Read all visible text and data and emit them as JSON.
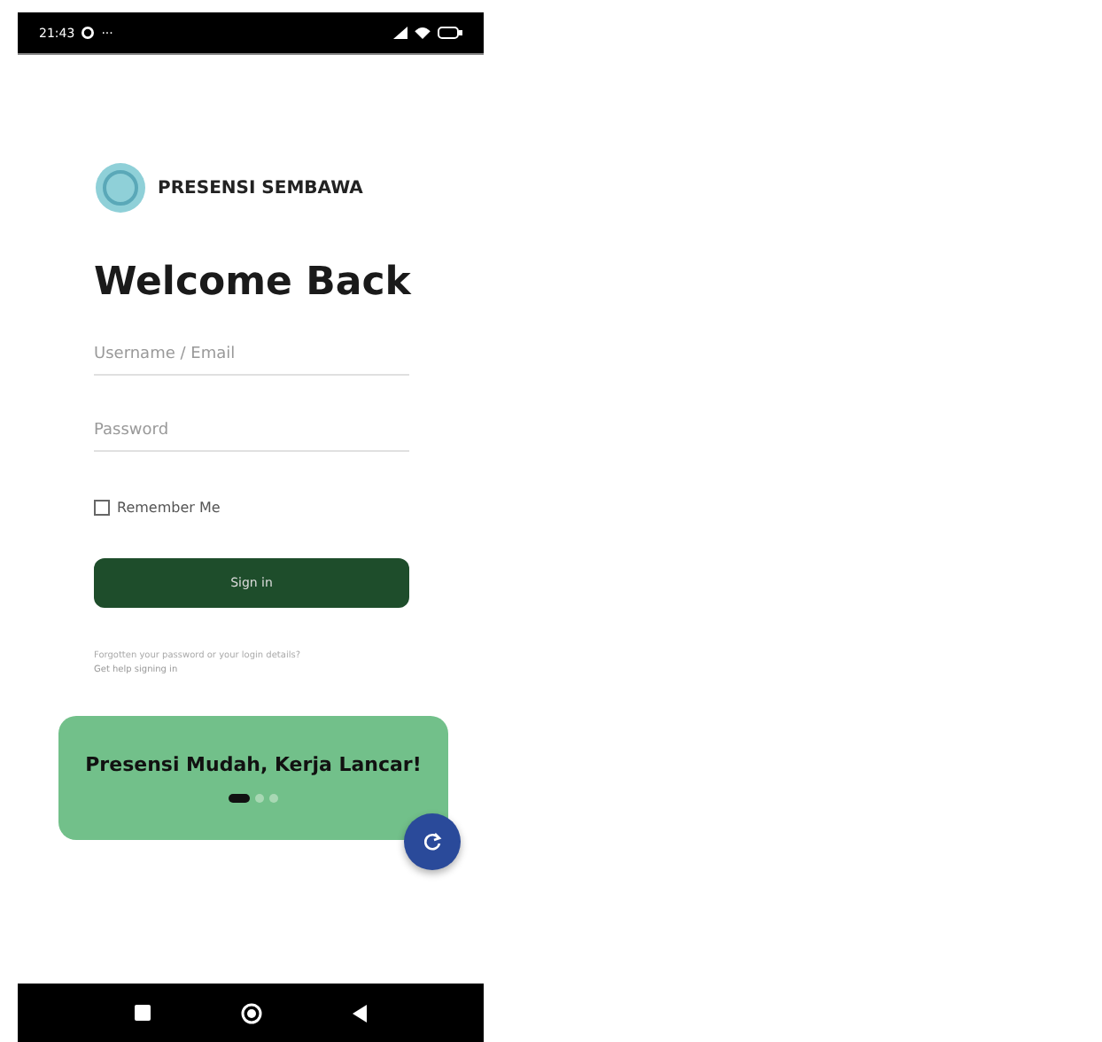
{
  "status_bar": {
    "time": "21:43",
    "extra": "···"
  },
  "app": {
    "name": "PRESENSI SEMBAWA"
  },
  "title": "Welcome Back",
  "fields": [
    {
      "placeholder": "Username / Email"
    },
    {
      "placeholder": "Password"
    }
  ],
  "remember": {
    "label": "Remember Me",
    "checked": false
  },
  "sign_in": "Sign in",
  "help": {
    "text": "Forgotten your password or your login details?",
    "link": "Get help signing in"
  },
  "banner": {
    "text": "Presensi Mudah, Kerja Lancar!",
    "dots": [
      {
        "selected": true
      },
      {
        "selected": false
      },
      {
        "selected": false
      }
    ]
  }
}
